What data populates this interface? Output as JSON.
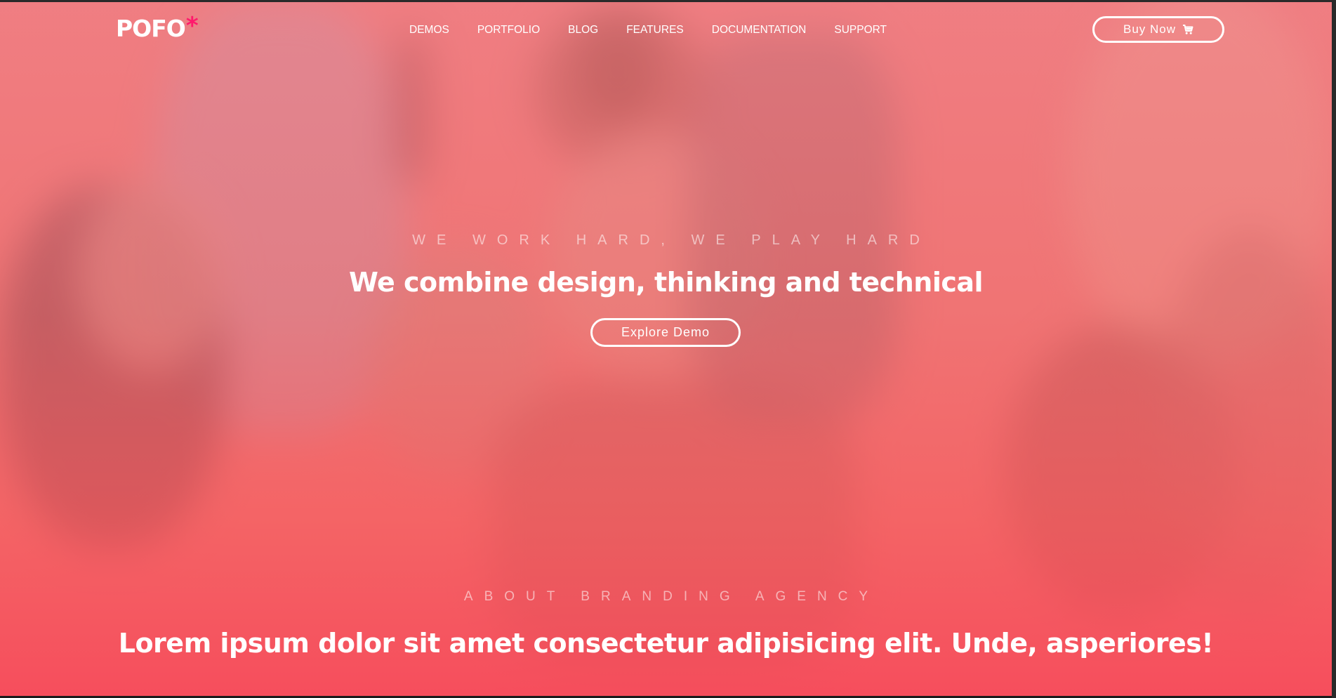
{
  "header": {
    "logo_text": "POFO",
    "logo_mark": "*",
    "nav": [
      {
        "label": "DEMOS"
      },
      {
        "label": "PORTFOLIO"
      },
      {
        "label": "BLOG"
      },
      {
        "label": "FEATURES"
      },
      {
        "label": "DOCUMENTATION"
      },
      {
        "label": "SUPPORT"
      }
    ],
    "buy_button": {
      "label": "Buy Now",
      "icon": "shopping-cart-icon"
    }
  },
  "hero": {
    "tagline": "WE WORK HARD, WE PLAY HARD",
    "title": "We combine design, thinking and technical",
    "cta_label": "Explore Demo"
  },
  "about": {
    "tagline": "ABOUT BRANDING AGENCY",
    "title": "Lorem ipsum dolor sit amet consectetur adipisicing elit. Unde, asperiores!"
  },
  "colors": {
    "accent": "#ff1a6c",
    "overlay_top": "#f48088",
    "overlay_bottom": "#f74a5a",
    "text": "#ffffff"
  }
}
